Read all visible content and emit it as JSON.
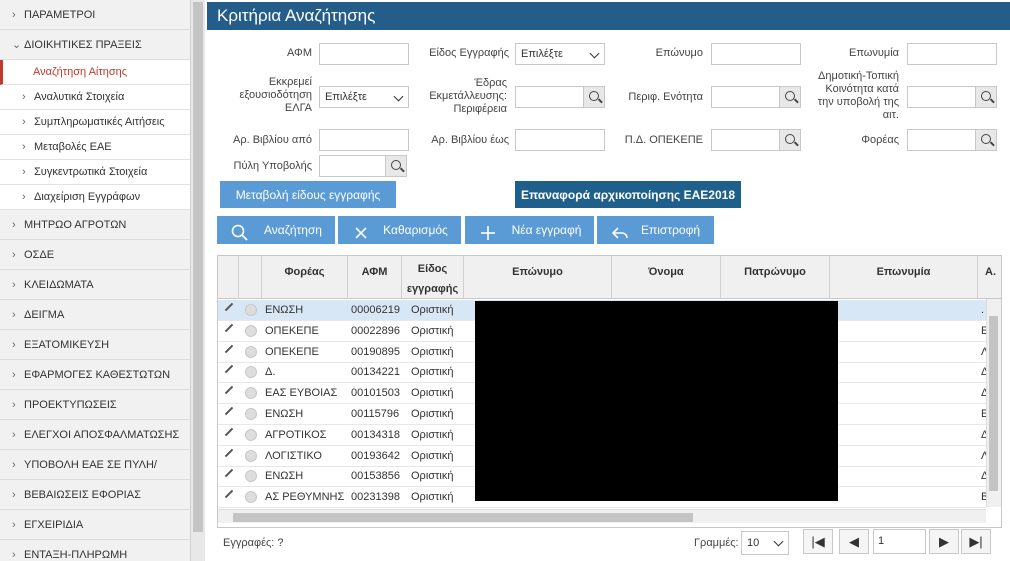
{
  "sidebar": {
    "items": [
      {
        "label": "ΠΑΡΑΜΕΤΡΟΙ"
      },
      {
        "label": "ΔΙΟΙΚΗΤΙΚΕΣ ΠΡΑΞΕΙΣ"
      },
      {
        "label": "Αναζήτηση Αίτησης"
      },
      {
        "label": "Αναλυτικά Στοιχεία"
      },
      {
        "label": "Συμπληρωματικές Αιτήσεις"
      },
      {
        "label": "Μεταβολές ΕΑΕ"
      },
      {
        "label": "Συγκεντρωτικά Στοιχεία"
      },
      {
        "label": "Διαχείριση Εγγράφων"
      },
      {
        "label": "ΜΗΤΡΩΟ ΑΓΡΟΤΩΝ"
      },
      {
        "label": "ΟΣΔΕ"
      },
      {
        "label": "ΚΛΕΙΔΩΜΑΤΑ"
      },
      {
        "label": "ΔΕΙΓΜΑ"
      },
      {
        "label": "ΕΞΑΤΟΜΙΚΕΥΣΗ"
      },
      {
        "label": "ΕΦΑΡΜΟΓΕΣ ΚΑΘΕΣΤΩΤΩΝ"
      },
      {
        "label": "ΠΡΟΕΚΤΥΠΩΣΕΙΣ"
      },
      {
        "label": "ΕΛΕΓΧΟΙ ΑΠΟΣΦΑΛΜΑΤΩΣΗΣ"
      },
      {
        "label": "ΥΠΟΒΟΛΗ ΕΑΕ ΣΕ ΠΥΛΗ/"
      },
      {
        "label": "ΒΕΒΑΙΩΣΕΙΣ ΕΦΟΡΙΑΣ"
      },
      {
        "label": "ΕΓΧΕΙΡΙΔΙΑ"
      },
      {
        "label": "ΕΝΤΑΞΗ-ΠΛΗΡΩΜΗ"
      }
    ]
  },
  "header": {
    "title": "Κριτήρια Αναζήτησης"
  },
  "form": {
    "afm": "ΑΦΜ",
    "eidos_eggrafis": "Είδος Εγγραφής",
    "eidos_value": "Επιλέξτε",
    "eponymo": "Επώνυμο",
    "eponymia": "Επωνυμία",
    "ekkremei_1": "Εκκρεμεί",
    "ekkremei_2": "εξουσιοδότηση",
    "ekkremei_3": "ΕΛΓΑ",
    "ekkremei_value": "Επιλέξτε",
    "edras_1": "Έδρας",
    "edras_2": "Εκμετάλλευσης:",
    "edras_3": "Περιφέρεια",
    "perif": "Περιφ. Ενότητα",
    "dimotiki_1": "Δημοτική-Τοπική",
    "dimotiki_2": "Κοινότητα κατά",
    "dimotiki_3": "την υποβολή της",
    "dimotiki_4": "αιτ.",
    "ar_apo": "Αρ. Βιβλίου από",
    "ar_eos": "Αρ. Βιβλίου έως",
    "pd": "Π.Δ. ΟΠΕΚΕΠΕ",
    "foreas": "Φορέας",
    "pyli": "Πύλη Υποβολής"
  },
  "buttons": {
    "metavoli": "Μεταβολή είδους εγγραφής",
    "epanafora": "Επαναφορά αρχικοποίησης ΕΑΕ2018",
    "search": "Αναζήτηση",
    "clear": "Καθαρισμός",
    "new": "Νέα εγγραφή",
    "back": "Επιστροφή"
  },
  "grid": {
    "columns": [
      {
        "label": ""
      },
      {
        "label": ""
      },
      {
        "label": "Φορέας"
      },
      {
        "label": "ΑΦΜ"
      },
      {
        "label": "Είδος εγγραφής"
      },
      {
        "label": "Επώνυμο"
      },
      {
        "label": "Όνομα"
      },
      {
        "label": "Πατρώνυμο"
      },
      {
        "label": "Επωνυμία"
      },
      {
        "label": "Α."
      }
    ],
    "rows": [
      {
        "foreas": "ΕΝΩΣΗ",
        "afm": "00006219",
        "eidos": "Οριστική",
        "edge": "."
      },
      {
        "foreas": "ΟΠΕΚΕΠΕ",
        "afm": "00022896",
        "eidos": "Οριστική",
        "edge": "Ε"
      },
      {
        "foreas": "ΟΠΕΚΕΠΕ",
        "afm": "00190895",
        "eidos": "Οριστική",
        "edge": "Λ"
      },
      {
        "foreas": "Δ.",
        "afm": "00134221",
        "eidos": "Οριστική",
        "edge": "Δ"
      },
      {
        "foreas": "ΕΑΣ ΕΥΒΟΙΑΣ",
        "afm": "00101503",
        "eigos": "",
        "eidos": "Οριστική",
        "edge": "Δ"
      },
      {
        "foreas": "ΕΝΩΣΗ",
        "afm": "00115796",
        "eidos": "Οριστική",
        "edge": "Ε"
      },
      {
        "foreas": "ΑΓΡΟΤΙΚΟΣ",
        "afm": "00134318",
        "eidos": "Οριστική",
        "edge": "Δ"
      },
      {
        "foreas": "ΛΟΓΙΣΤΙΚΟ",
        "afm": "00193642",
        "eidos": "Οριστική",
        "edge": "Λ"
      },
      {
        "foreas": "ΕΝΩΣΗ",
        "afm": "00153856",
        "eidos": "Οριστική",
        "edge": "Δ"
      },
      {
        "foreas": "ΑΣ ΡΕΘΥΜΝΗΣ",
        "afm": "00231398",
        "eidos": "Οριστική",
        "edge": "Β"
      }
    ]
  },
  "footer": {
    "records": "Εγγραφές: ?",
    "rows_label": "Γραμμές:",
    "rows_value": "10",
    "page": "1"
  },
  "colors": {
    "accent": "#255d8a",
    "button": "#5b9bd5",
    "button_dark": "#1f5f8b",
    "active": "#c0392b"
  }
}
